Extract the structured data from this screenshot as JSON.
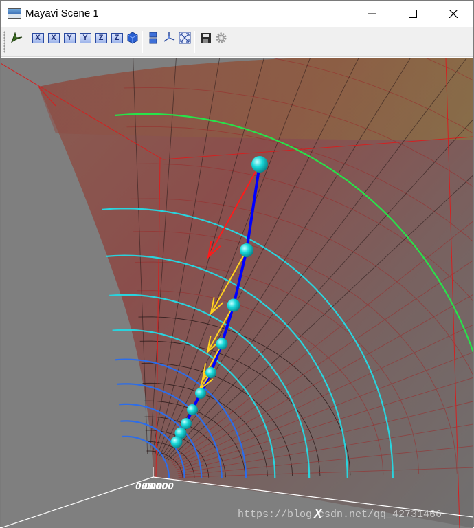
{
  "window": {
    "title": "Mayavi Scene 1",
    "controls": {
      "minimize": "minimize",
      "maximize": "maximize",
      "close": "close"
    }
  },
  "toolbar": {
    "buttons": [
      {
        "name": "pipeline-icon",
        "label": ""
      },
      {
        "name": "view-x-minus-button",
        "label": "X"
      },
      {
        "name": "view-x-plus-button",
        "label": "X"
      },
      {
        "name": "view-y-minus-button",
        "label": "Y"
      },
      {
        "name": "view-y-plus-button",
        "label": "Y"
      },
      {
        "name": "view-z-minus-button",
        "label": "Z"
      },
      {
        "name": "view-z-plus-button",
        "label": "Z"
      },
      {
        "name": "isometric-view-button",
        "label": ""
      },
      {
        "name": "parallel-projection-button",
        "label": ""
      },
      {
        "name": "toggle-axes-button",
        "label": ""
      },
      {
        "name": "full-screen-button",
        "label": ""
      },
      {
        "name": "save-button",
        "label": ""
      },
      {
        "name": "configure-button",
        "label": ""
      }
    ]
  },
  "scene": {
    "axis_label": "X",
    "tick_label": "0.000",
    "watermark": "https://blog.csdn.net/qq_42731466",
    "colors": {
      "background": "#7f7f7f",
      "path": "#0000ff",
      "points": "#19d9d9",
      "gradient_arrow_first": "#ff1a1a",
      "gradient_arrows": "#ffd21f",
      "contour_outer": "#27e34a",
      "contour_mid": "#2ad3dd",
      "contour_inner": "#2c6dea"
    },
    "path_points": 10,
    "contour_levels": 10
  }
}
